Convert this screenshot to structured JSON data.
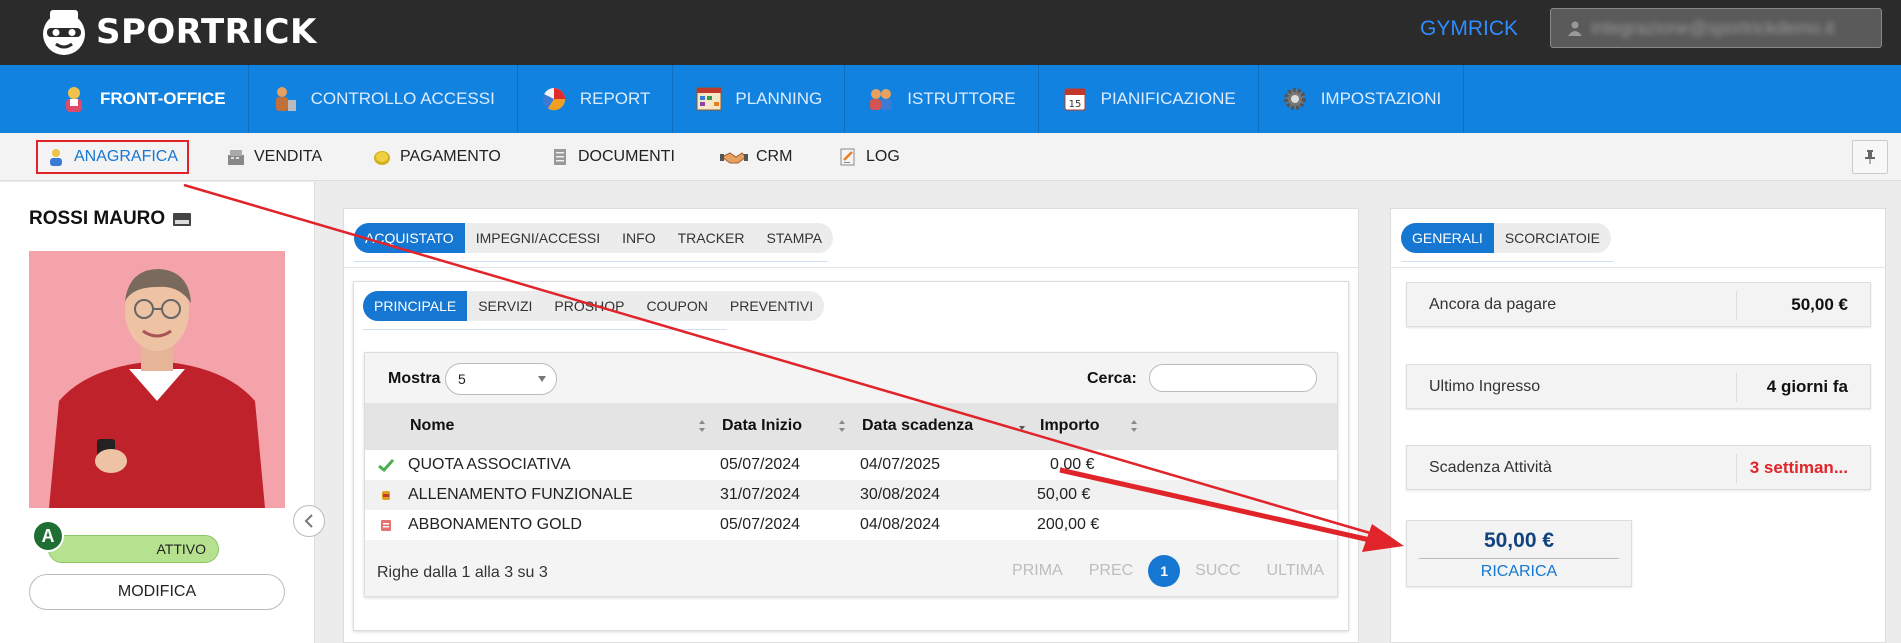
{
  "topbar": {
    "brand": "SPORTRICK",
    "gym_link": "GYMRICK",
    "user_email": "integrazione@sportrickdemo.it"
  },
  "main_nav": [
    {
      "label": "FRONT-OFFICE",
      "icon": "front-office-icon",
      "active": true
    },
    {
      "label": "CONTROLLO ACCESSI",
      "icon": "access-control-icon",
      "active": false
    },
    {
      "label": "REPORT",
      "icon": "pie-chart-icon",
      "active": false
    },
    {
      "label": "PLANNING",
      "icon": "calendar-grid-icon",
      "active": false
    },
    {
      "label": "ISTRUTTORE",
      "icon": "instructor-icon",
      "active": false
    },
    {
      "label": "PIANIFICAZIONE",
      "icon": "calendar-icon",
      "active": false
    },
    {
      "label": "IMPOSTAZIONI",
      "icon": "gear-icon",
      "active": false
    }
  ],
  "sub_nav": [
    {
      "label": "ANAGRAFICA",
      "icon": "person-icon",
      "active": true
    },
    {
      "label": "VENDITA",
      "icon": "cash-register-icon",
      "active": false
    },
    {
      "label": "PAGAMENTO",
      "icon": "coin-icon",
      "active": false
    },
    {
      "label": "DOCUMENTI",
      "icon": "documents-icon",
      "active": false
    },
    {
      "label": "CRM",
      "icon": "handshake-icon",
      "active": false
    },
    {
      "label": "LOG",
      "icon": "log-icon",
      "active": false
    }
  ],
  "customer": {
    "name": "ROSSI MAURO",
    "level_badge": "A",
    "status": "ATTIVO",
    "edit_label": "MODIFICA"
  },
  "center": {
    "top_tabs": [
      "ACQUISTATO",
      "IMPEGNI/ACCESSI",
      "INFO",
      "TRACKER",
      "STAMPA"
    ],
    "sub_tabs": [
      "PRINCIPALE",
      "SERVIZI",
      "PROSHOP",
      "COUPON",
      "PREVENTIVI"
    ],
    "table": {
      "show_label": "Mostra",
      "show_value": "5",
      "search_label": "Cerca:",
      "search_value": "",
      "columns": [
        "Nome",
        "Data Inizio",
        "Data scadenza",
        "Importo"
      ],
      "rows": [
        {
          "icon": "check-icon",
          "name": "QUOTA ASSOCIATIVA",
          "start": "05/07/2024",
          "end": "04/07/2025",
          "amount": "0,00 €"
        },
        {
          "icon": "dumbbell-icon",
          "name": "ALLENAMENTO FUNZIONALE",
          "start": "31/07/2024",
          "end": "30/08/2024",
          "amount": "50,00 €"
        },
        {
          "icon": "subscription-icon",
          "name": "ABBONAMENTO GOLD",
          "start": "05/07/2024",
          "end": "04/08/2024",
          "amount": "200,00 €"
        }
      ],
      "footer_info": "Righe dalla 1 alla 3 su 3",
      "pager": {
        "first": "PRIMA",
        "prev": "PREC",
        "current": "1",
        "next": "SUCC",
        "last": "ULTIMA"
      }
    }
  },
  "right": {
    "tabs": [
      "GENERALI",
      "SCORCIATOIE"
    ],
    "cards": [
      {
        "label": "Ancora da pagare",
        "value": "50,00 €",
        "alert": false
      },
      {
        "label": "Ultimo Ingresso",
        "value": "4 giorni fa",
        "alert": false
      },
      {
        "label": "Scadenza Attività",
        "value": "3 settiman...",
        "alert": true
      }
    ],
    "recharge": {
      "amount": "50,00 €",
      "link": "RICARICA"
    }
  },
  "colors": {
    "topbar": "#2b2b2b",
    "nav_blue": "#1282e0",
    "accent_blue": "#1677d2",
    "annotation_red": "#e0242a",
    "status_green": "#b6e28f"
  }
}
